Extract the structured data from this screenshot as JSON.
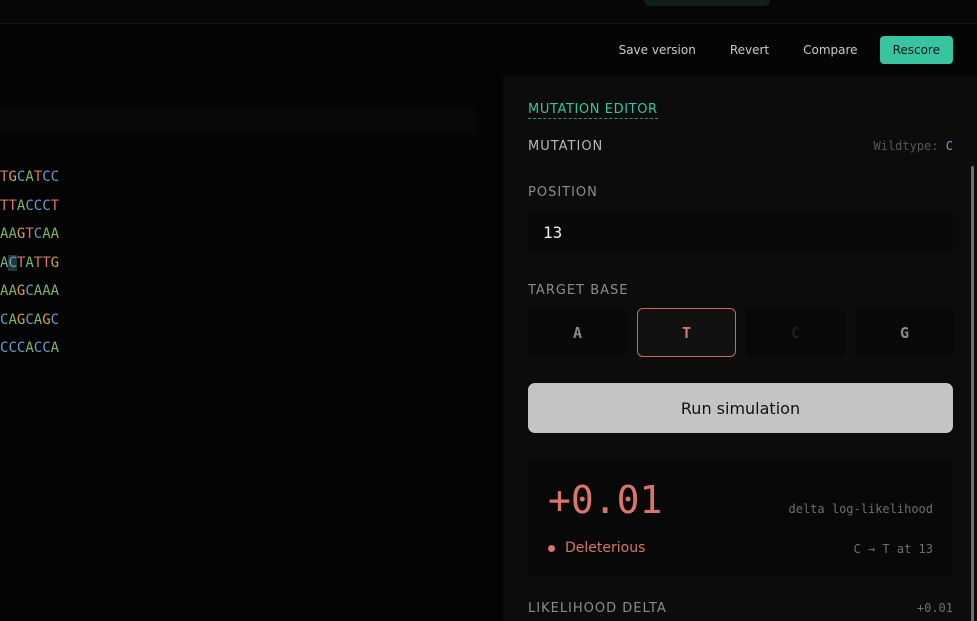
{
  "toolbar": {
    "save_version": "Save version",
    "revert": "Revert",
    "compare": "Compare",
    "rescore": "Rescore"
  },
  "sequence": {
    "lines": [
      [
        {
          "b": "T"
        },
        {
          "b": "G"
        },
        {
          "b": "C"
        },
        {
          "b": "A"
        },
        {
          "b": "T"
        },
        {
          "b": "C"
        },
        {
          "b": "C"
        }
      ],
      [
        {
          "b": "T"
        },
        {
          "b": "T"
        },
        {
          "b": "A"
        },
        {
          "b": "C"
        },
        {
          "b": "C"
        },
        {
          "b": "C"
        },
        {
          "b": "T"
        }
      ],
      [
        {
          "b": "A"
        },
        {
          "b": "A"
        },
        {
          "b": "G"
        },
        {
          "b": "T"
        },
        {
          "b": "C"
        },
        {
          "b": "A"
        },
        {
          "b": "A"
        }
      ],
      [
        {
          "b": "A"
        },
        {
          "b": "C",
          "hl": true
        },
        {
          "b": "T"
        },
        {
          "b": "A"
        },
        {
          "b": "T"
        },
        {
          "b": "T"
        },
        {
          "b": "G"
        }
      ],
      [
        {
          "b": "A"
        },
        {
          "b": "A"
        },
        {
          "b": "G"
        },
        {
          "b": "C"
        },
        {
          "b": "A"
        },
        {
          "b": "A"
        },
        {
          "b": "A"
        }
      ],
      [
        {
          "b": "C"
        },
        {
          "b": "A"
        },
        {
          "b": "G"
        },
        {
          "b": "C"
        },
        {
          "b": "A"
        },
        {
          "b": "G"
        },
        {
          "b": "C"
        }
      ],
      [
        {
          "b": "C"
        },
        {
          "b": "C"
        },
        {
          "b": "C"
        },
        {
          "b": "A"
        },
        {
          "b": "C"
        },
        {
          "b": "C"
        },
        {
          "b": "A"
        }
      ]
    ]
  },
  "editor": {
    "title": "MUTATION EDITOR",
    "mutation_label": "MUTATION",
    "wildtype_label": "Wildtype:",
    "wildtype_value": "C",
    "position_label": "POSITION",
    "position_value": "13",
    "target_label": "TARGET BASE",
    "bases": [
      "A",
      "T",
      "C",
      "G"
    ],
    "selected_base": "T",
    "run_label": "Run simulation",
    "result": {
      "delta": "+0.01",
      "delta_label": "delta log-likelihood",
      "verdict": "Deleterious",
      "change": "C → T at 13"
    },
    "likelihood_label": "LIKELIHOOD DELTA",
    "likelihood_value": "+0.01"
  },
  "colors": {
    "accent": "#39c4a1",
    "A": "#7fb36a",
    "T": "#d8766c",
    "C": "#6f9bd0",
    "G": "#d3a24e"
  }
}
